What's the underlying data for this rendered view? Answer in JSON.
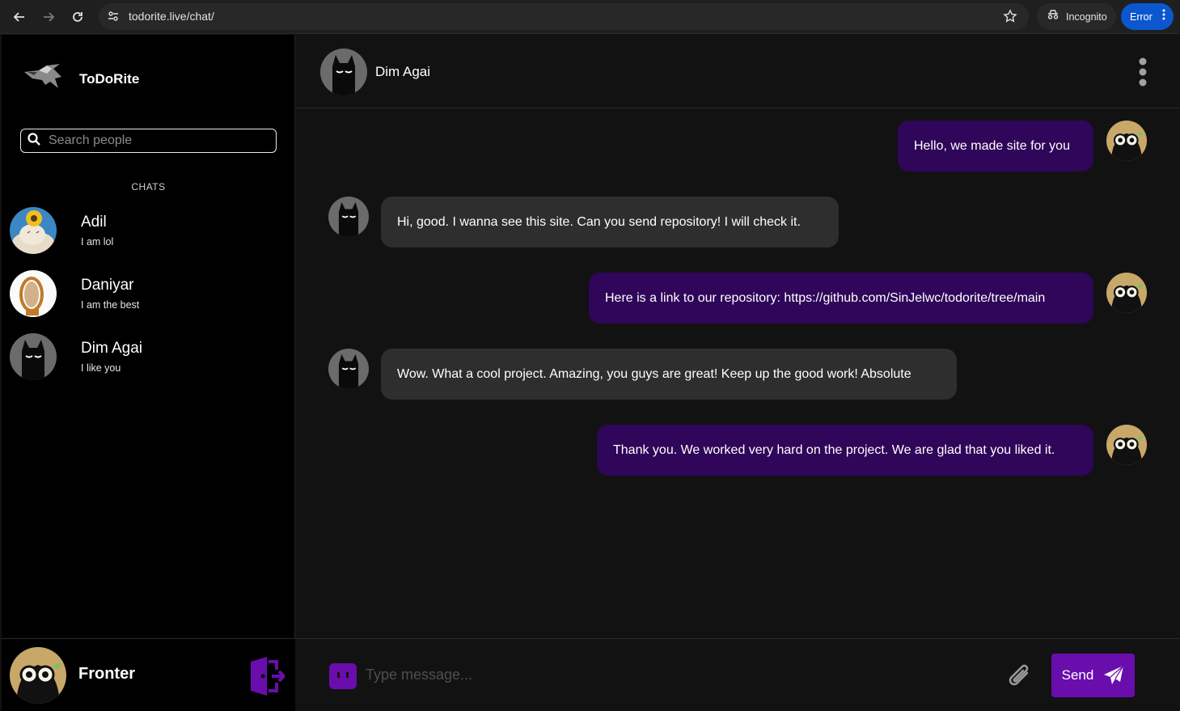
{
  "browser": {
    "url": "todorite.live/chat/",
    "incognito_label": "Incognito",
    "error_label": "Error"
  },
  "sidebar": {
    "brand": "ToDoRite",
    "search_placeholder": "Search people",
    "section_label": "CHATS",
    "chats": [
      {
        "name": "Adil",
        "last_message": "I am lol",
        "avatar": "cat-sunflower-avatar"
      },
      {
        "name": "Daniyar",
        "last_message": "I am the best",
        "avatar": "mirror-avatar"
      },
      {
        "name": "Dim Agai",
        "last_message": "I like you",
        "avatar": "black-cat-avatar"
      }
    ],
    "current_user": {
      "name": "Fronter",
      "avatar": "owl-cat-avatar"
    }
  },
  "chat": {
    "contact_name": "Dim Agai",
    "messages": [
      {
        "direction": "out",
        "text": "Hello, we made site for you"
      },
      {
        "direction": "in",
        "text": "Hi, good. I wanna see this site. Can you send repository! I will check it."
      },
      {
        "direction": "out",
        "text": "Here is a link to our repository: https://github.com/SinJelwc/todorite/tree/main"
      },
      {
        "direction": "in",
        "text": "Wow. What a cool project. Amazing, you guys are great! Keep up the good work! Absolute"
      },
      {
        "direction": "out",
        "text": "Thank you. We worked very hard on the project. We are glad that you liked it."
      }
    ],
    "composer": {
      "placeholder": "Type message...",
      "send_label": "Send"
    }
  },
  "colors": {
    "accent": "#6a0dad",
    "outgoing_bubble": "#2f0659",
    "incoming_bubble": "#2e2e2e",
    "background": "#121212",
    "sidebar": "#000000"
  }
}
